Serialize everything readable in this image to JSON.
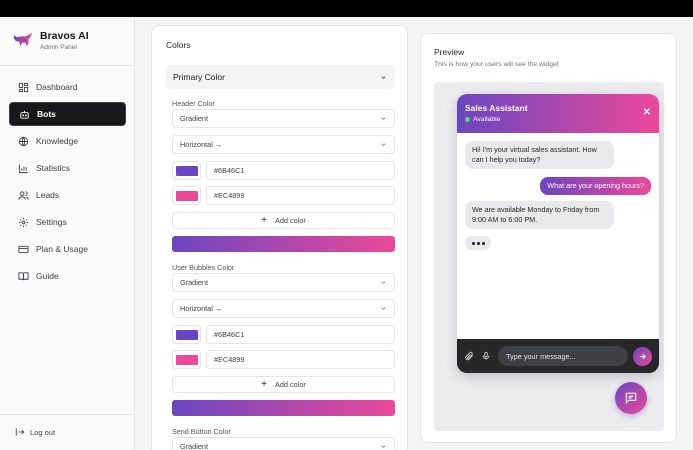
{
  "brand": {
    "title": "Bravos AI",
    "subtitle": "Admin Panel"
  },
  "sidebar": {
    "items": [
      {
        "label": "Dashboard",
        "icon": "dashboard-icon",
        "active": false
      },
      {
        "label": "Bots",
        "icon": "bot-icon",
        "active": true
      },
      {
        "label": "Knowledge",
        "icon": "globe-icon",
        "active": false
      },
      {
        "label": "Statistics",
        "icon": "bar-chart-icon",
        "active": false
      },
      {
        "label": "Leads",
        "icon": "users-icon",
        "active": false
      },
      {
        "label": "Settings",
        "icon": "gear-icon",
        "active": false
      },
      {
        "label": "Plan & Usage",
        "icon": "credit-card-icon",
        "active": false
      },
      {
        "label": "Guide",
        "icon": "book-icon",
        "active": false
      }
    ],
    "logout_label": "Log out"
  },
  "colors": {
    "title": "Colors",
    "primary_section": "Primary Color",
    "header": {
      "label": "Header Color",
      "type": "Gradient",
      "direction": "Horizontal →",
      "color1": "#6B46C1",
      "color2": "#EC4899",
      "add_color": "Add color"
    },
    "user_bubbles": {
      "label": "User Bubbles Color",
      "type": "Gradient",
      "direction": "Horizontal →",
      "color1": "#6B46C1",
      "color2": "#EC4899",
      "add_color": "Add color"
    },
    "send_button": {
      "label": "Send Button Color",
      "type": "Gradient"
    }
  },
  "preview": {
    "title": "Preview",
    "subtitle": "This is how your users will see the widget",
    "widget": {
      "title": "Sales Assistant",
      "status": "Available",
      "messages": [
        {
          "from": "bot",
          "text": "Hi! I'm your virtual sales assistant. How can I help you today?"
        },
        {
          "from": "user",
          "text": "What are your opening hours?"
        },
        {
          "from": "bot",
          "text": "We are available Monday to Friday from 9:00 AM to 6:00 PM."
        }
      ],
      "input_placeholder": "Type your message..."
    }
  },
  "theme": {
    "gradient_start": "#6B46C1",
    "gradient_end": "#EC4899",
    "status_color": "#4ade80"
  }
}
